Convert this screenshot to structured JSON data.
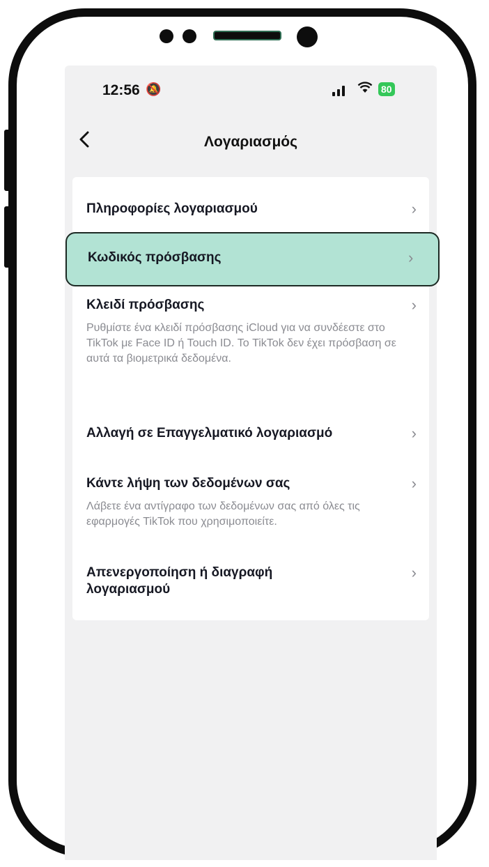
{
  "status_bar": {
    "time": "12:56",
    "battery": "80"
  },
  "nav": {
    "back_icon": "chevron-left-icon",
    "title": "Λογαριασμός"
  },
  "items": [
    {
      "title": "Πληροφορίες λογαριασμού",
      "description": ""
    },
    {
      "title": "Κωδικός πρόσβασης",
      "description": "",
      "highlighted": true
    },
    {
      "title": "Κλειδί πρόσβασης",
      "description": "Ρυθμίστε ένα κλειδί πρόσβασης iCloud για να συνδέεστε στο TikTok με Face ID ή Touch ID. Το TikTok δεν έχει πρόσβαση σε αυτά τα βιομετρικά δεδομένα."
    },
    {
      "title": "Αλλαγή σε Επαγγελματικό λογαριασμό",
      "description": ""
    },
    {
      "title": "Κάντε λήψη των δεδομένων σας",
      "description": "Λάβετε ένα αντίγραφο των δεδομένων σας από όλες τις εφαρμογές TikTok που χρησιμοποιείτε."
    },
    {
      "title": "Απενεργοποίηση ή διαγραφή λογαριασμού",
      "description": ""
    }
  ],
  "colors": {
    "highlight": "#b2e3d4",
    "battery": "#34c759"
  }
}
